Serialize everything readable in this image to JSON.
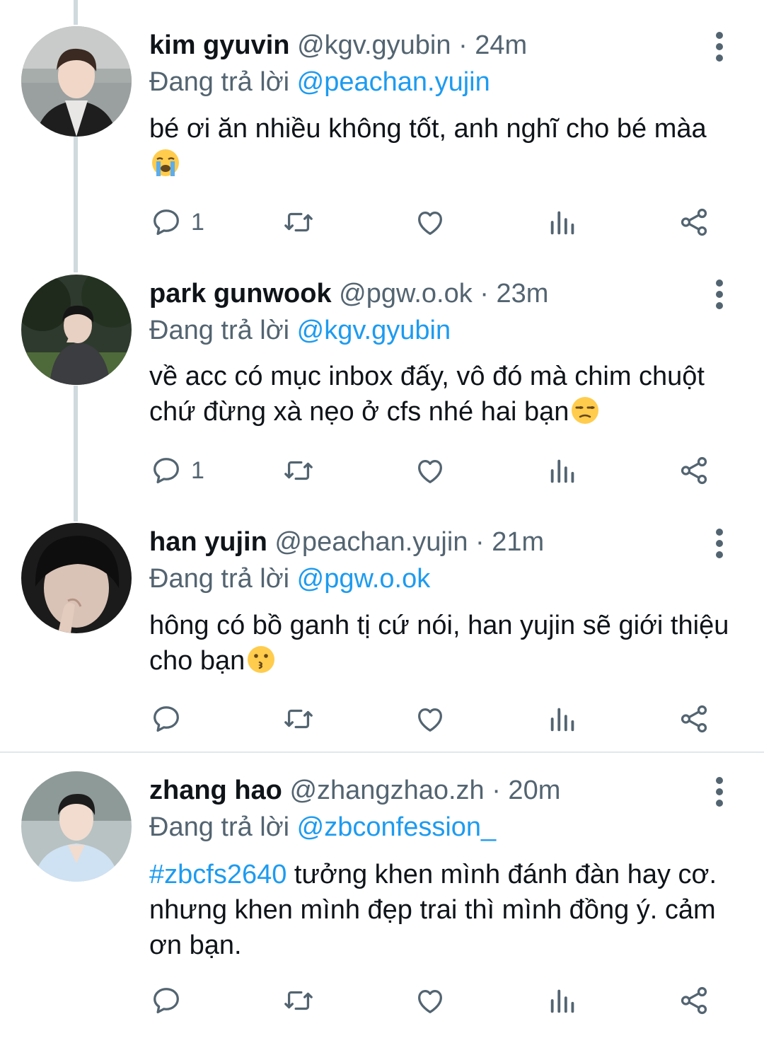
{
  "tweets": [
    {
      "name": "kim gyuvin",
      "handle": "@kgv.gyubin",
      "time": "· 24m",
      "reply_prefix": "Đang trả lời ",
      "reply_to": "@peachan.yujin",
      "text": "bé ơi ăn nhiều không tốt, anh nghĩ cho bé màa",
      "emoji": "loudly-crying-face",
      "reply_count": "1",
      "avatar": "avatar-photo"
    },
    {
      "name": "park gunwook",
      "handle": "@pgw.o.ok",
      "time": "· 23m",
      "reply_prefix": "Đang trả lời ",
      "reply_to": "@kgv.gyubin",
      "text": "về acc có mục inbox đấy, vô đó mà chim chuột chứ đừng xà nẹo ở cfs nhé hai bạn",
      "emoji": "unamused-face",
      "reply_count": "1",
      "avatar": "avatar-photo"
    },
    {
      "name": "han yujin",
      "handle": "@peachan.yujin",
      "time": "· 21m",
      "reply_prefix": "Đang trả lời ",
      "reply_to": "@pgw.o.ok",
      "text": "hông có bồ ganh tị cứ nói, han yujin sẽ giới thiệu cho bạn",
      "emoji": "kissing-face",
      "reply_count": "",
      "avatar": "avatar-photo"
    },
    {
      "name": "zhang hao",
      "handle": "@zhangzhao.zh",
      "time": "· 20m",
      "reply_prefix": "Đang trả lời ",
      "reply_to": "@zbconfession_",
      "hashtag": "#zbcfs2640",
      "text": " tưởng khen mình đánh đàn hay cơ. nhưng khen mình đẹp trai thì mình đồng ý. cảm ơn bạn.",
      "reply_count": "",
      "avatar": "avatar-photo"
    }
  ],
  "icons": {
    "reply": "reply-icon",
    "retweet": "retweet-icon",
    "like": "like-icon",
    "views": "views-icon",
    "share": "share-icon",
    "more": "more-icon"
  },
  "colors": {
    "link": "#1d9bf0",
    "secondary_text": "#536471",
    "primary_text": "#0f1419",
    "thread_line": "#cfd9de"
  }
}
